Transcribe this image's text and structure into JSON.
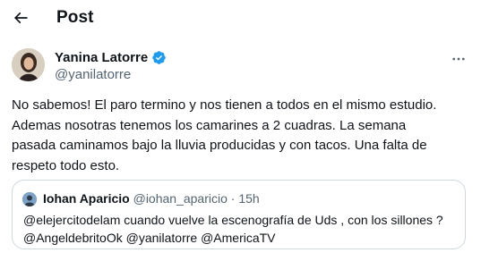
{
  "header": {
    "title": "Post",
    "back_icon": "arrow-left-icon"
  },
  "author": {
    "name": "Yanina Latorre",
    "handle": "@yanilatorre",
    "verified": true,
    "verified_color": "#1d9bf0"
  },
  "post": {
    "lines": [
      "No sabemos! El paro termino y nos tienen a todos en el mismo estudio.",
      "Ademas nosotras tenemos los camarines a 2 cuadras. La semana",
      "pasada caminamos bajo la lluvia producidas y con tacos. Una falta de",
      "respeto todo esto."
    ]
  },
  "quote": {
    "name": "Iohan Aparicio",
    "handle": "@iohan_aparicio",
    "separator": "·",
    "time": "15h",
    "lines": [
      "@elejercitodelam cuando vuelve la escenografía de Uds , con los sillones ?",
      "@AngeldebritoOk @yanilatorre @AmericaTV"
    ]
  },
  "icons": {
    "more": "more-horizontal-icon"
  }
}
